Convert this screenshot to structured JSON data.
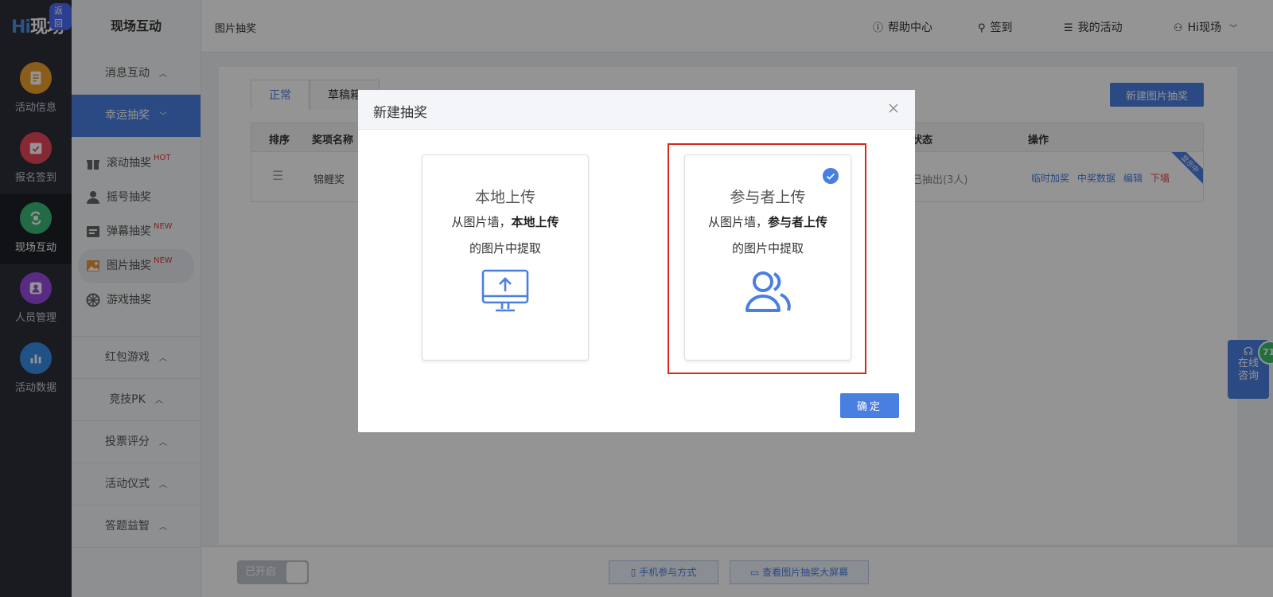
{
  "brand": {
    "logo_hi": "Hi",
    "logo_text": "现场",
    "back_label": "返回"
  },
  "rail": [
    {
      "label": "活动信息",
      "color": "#f0a030",
      "icon": "document-icon"
    },
    {
      "label": "报名签到",
      "color": "#e8485a",
      "icon": "calendar-check-icon"
    },
    {
      "label": "现场互动",
      "color": "#3cb878",
      "icon": "interaction-icon"
    },
    {
      "label": "人员管理",
      "color": "#9b4ae0",
      "icon": "person-card-icon"
    },
    {
      "label": "活动数据",
      "color": "#3a8ee6",
      "icon": "bar-chart-icon"
    }
  ],
  "sidebar": {
    "title": "现场互动",
    "groups_top": [
      {
        "label": "消息互动"
      },
      {
        "label": "幸运抽奖"
      }
    ],
    "sub_items": [
      {
        "label": "滚动抽奖",
        "tag": "HOT"
      },
      {
        "label": "摇号抽奖",
        "tag": ""
      },
      {
        "label": "弹幕抽奖",
        "tag": "NEW"
      },
      {
        "label": "图片抽奖",
        "tag": "NEW"
      },
      {
        "label": "游戏抽奖",
        "tag": ""
      }
    ],
    "groups_bottom": [
      {
        "label": "红包游戏"
      },
      {
        "label": "竞技PK"
      },
      {
        "label": "投票评分"
      },
      {
        "label": "活动仪式"
      },
      {
        "label": "答题益智"
      }
    ]
  },
  "header": {
    "breadcrumb": "图片抽奖",
    "help": "帮助中心",
    "signin": "签到",
    "my_activity": "我的活动",
    "user": "Hi现场"
  },
  "content": {
    "tabs": [
      {
        "label": "正常"
      },
      {
        "label": "草稿箱"
      }
    ],
    "new_button": "新建图片抽奖",
    "columns": {
      "order": "排序",
      "name": "奖项名称",
      "status": "状态",
      "ops": "操作"
    },
    "row": {
      "name": "锦鲤奖",
      "status": "已抽出(3人)",
      "ops": [
        "临时加奖",
        "中奖数据",
        "编辑",
        "下墙"
      ],
      "ribbon": "显示中"
    }
  },
  "bottom": {
    "toggle": "已开启",
    "mobile": "手机参与方式",
    "screen": "查看图片抽奖大屏幕"
  },
  "consult": {
    "line1": "在线",
    "line2": "咨询",
    "badge": "71"
  },
  "modal": {
    "title": "新建抽奖",
    "options": [
      {
        "title": "本地上传",
        "line1_prefix": "从图片墙，",
        "line1_bold": "本地上传",
        "line2": "的图片中提取",
        "icon": "monitor-upload-icon"
      },
      {
        "title": "参与者上传",
        "line1_prefix": "从图片墙，",
        "line1_bold": "参与者上传",
        "line2": "的图片中提取",
        "icon": "users-icon"
      }
    ],
    "ok": "确定"
  }
}
